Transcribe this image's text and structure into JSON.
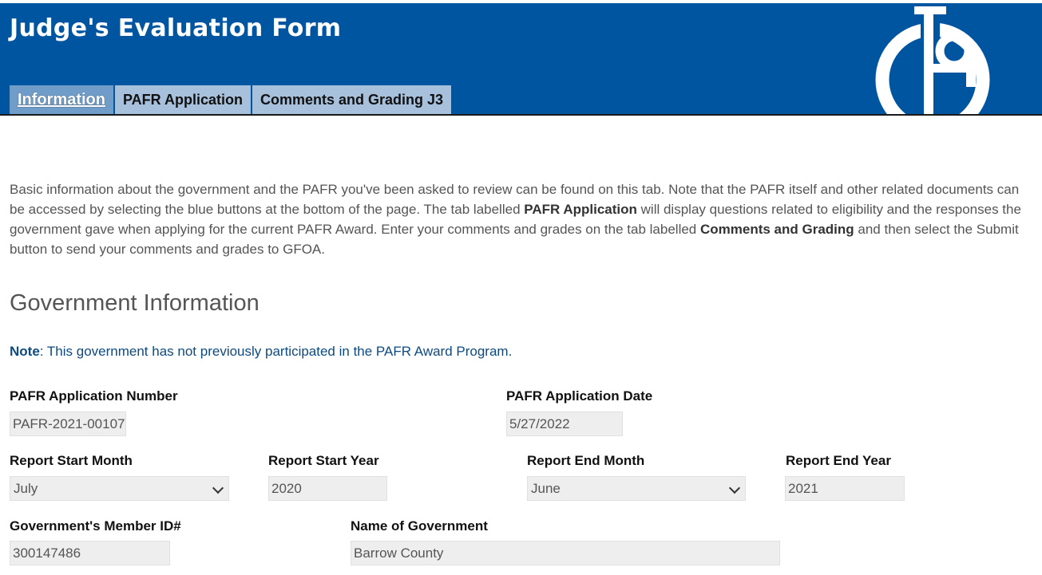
{
  "header": {
    "title": "Judge's Evaluation Form",
    "logo_icon": "gfoa-logo",
    "tabs": [
      {
        "label": "Information",
        "active": true
      },
      {
        "label": "PAFR Application",
        "active": false
      },
      {
        "label": "Comments and Grading J3",
        "active": false
      }
    ]
  },
  "intro": {
    "part1": "Basic information about the government and the PAFR you've been asked to review can be found on this tab. Note that the PAFR itself and other related documents can be accessed by selecting the blue buttons at the bottom of the page. The tab labelled ",
    "bold1": "PAFR Application",
    "part2": " will display questions related to eligibility and the responses the government gave when applying for the current PAFR Award. Enter your comments and grades on the tab labelled ",
    "bold2": "Comments and Grading",
    "part3": " and then select the Submit button to send your comments and grades to GFOA."
  },
  "section": {
    "title": "Government Information",
    "note_label": "Note",
    "note_text": ": This government has not previously participated in the PAFR Award Program."
  },
  "fields": {
    "app_number": {
      "label": "PAFR Application Number",
      "value": "PAFR-2021-00107"
    },
    "app_date": {
      "label": "PAFR Application Date",
      "value": "5/27/2022"
    },
    "start_month": {
      "label": "Report Start Month",
      "value": "July"
    },
    "start_year": {
      "label": "Report Start Year",
      "value": "2020"
    },
    "end_month": {
      "label": "Report End Month",
      "value": "June"
    },
    "end_year": {
      "label": "Report End Year",
      "value": "2021"
    },
    "member_id": {
      "label": "Government's Member ID#",
      "value": "300147486"
    },
    "gov_name": {
      "label": "Name of Government",
      "value": "Barrow County"
    }
  },
  "colors": {
    "header_bg": "#0055a0",
    "tab_bg": "#a7c1dd",
    "tab_active_bg": "#6f9cc8",
    "note": "#0d4a80"
  }
}
